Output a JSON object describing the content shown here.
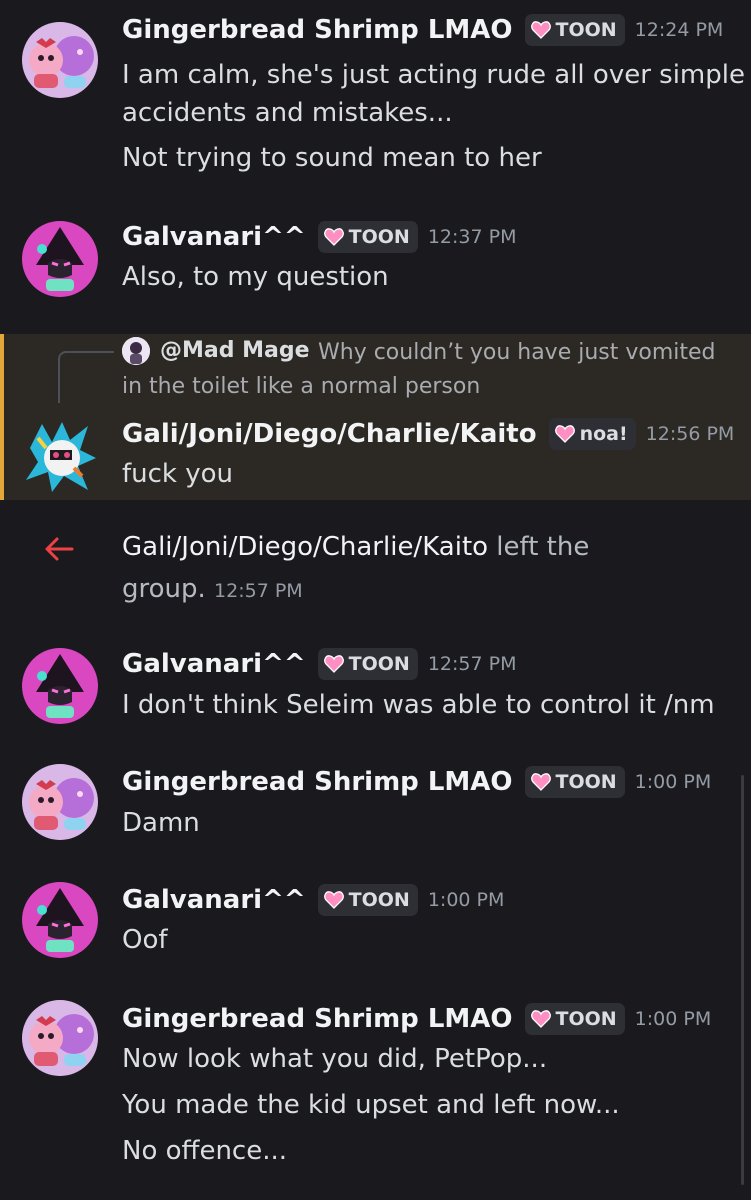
{
  "colors": {
    "background": "#1a1a1e",
    "reply_highlight_bg": "#2c2823",
    "reply_highlight_border": "#e4a73a",
    "system_arrow": "#ed4245",
    "tag_bg": "#2e2f35"
  },
  "messages": [
    {
      "author": "Gingerbread Shrimp LMAO",
      "tag": "TOON",
      "tag_icon": "pink-heart-icon",
      "time": "12:24 PM",
      "avatar": "pink-character-avatar",
      "lines": [
        "I am calm, she's just acting rude all over simple",
        "accidents and mistakes...",
        "Not trying to sound mean to her"
      ]
    },
    {
      "author": "Galvanari^^",
      "tag": "TOON",
      "tag_icon": "pink-heart-icon",
      "time": "12:37 PM",
      "avatar": "magenta-hooded-character-avatar",
      "lines": [
        "Also, to my question"
      ]
    },
    {
      "reply_to": {
        "author": "@Mad Mage",
        "text_line1": "Why couldn’t you have just vomited",
        "text_line2": "in the toilet like a normal person"
      },
      "author": "Gali/Joni/Diego/Charlie/Kaito",
      "tag": "noa!",
      "tag_icon": "pink-heart-icon",
      "time": "12:56 PM",
      "avatar": "colorful-character-avatar",
      "lines": [
        "fuck you"
      ]
    },
    {
      "author": "Galvanari^^",
      "tag": "TOON",
      "tag_icon": "pink-heart-icon",
      "time": "12:57 PM",
      "avatar": "magenta-hooded-character-avatar",
      "lines": [
        "I don't think Seleim was able to control it /nm"
      ]
    },
    {
      "author": "Gingerbread Shrimp LMAO",
      "tag": "TOON",
      "tag_icon": "pink-heart-icon",
      "time": "1:00 PM",
      "avatar": "pink-character-avatar",
      "lines": [
        "Damn"
      ]
    },
    {
      "author": "Galvanari^^",
      "tag": "TOON",
      "tag_icon": "pink-heart-icon",
      "time": "1:00 PM",
      "avatar": "magenta-hooded-character-avatar",
      "lines": [
        "Oof"
      ]
    },
    {
      "author": "Gingerbread Shrimp LMAO",
      "tag": "TOON",
      "tag_icon": "pink-heart-icon",
      "time": "1:00 PM",
      "avatar": "pink-character-avatar",
      "lines": [
        "Now look what you did, PetPop...",
        "You made the kid upset and left now...",
        "No offence..."
      ]
    }
  ],
  "system_event": {
    "icon": "left-arrow-icon",
    "user": "Gali/Joni/Diego/Charlie/Kaito",
    "text_after_user": " left the",
    "text_line2": "group.",
    "time": "12:57 PM"
  }
}
